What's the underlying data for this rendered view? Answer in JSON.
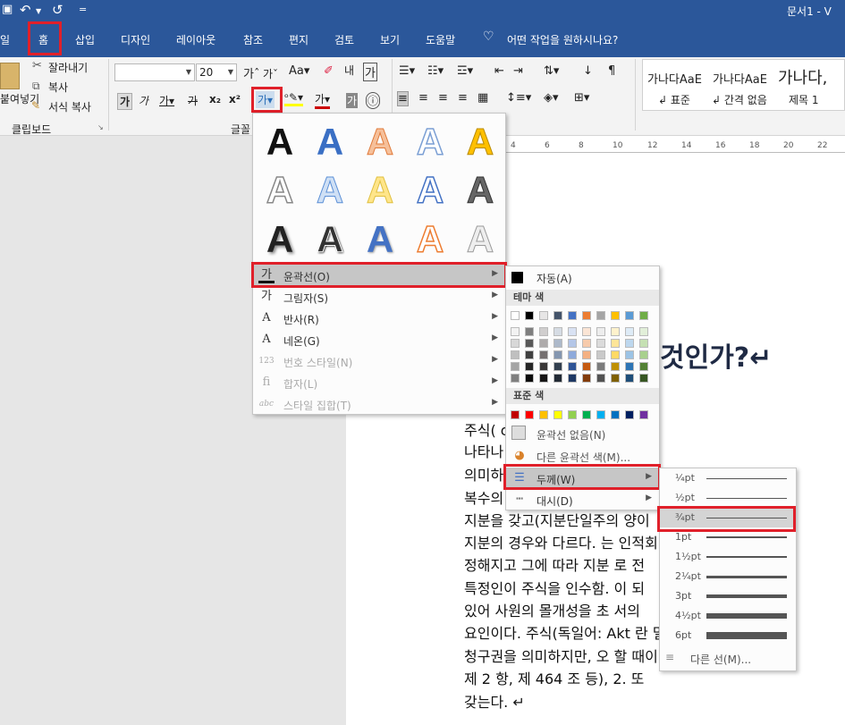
{
  "titlebar": {
    "quick_access": [
      "↶",
      "↺",
      "="
    ],
    "doc_title": "문서1 - V"
  },
  "tabs": [
    "일",
    "홈",
    "삽입",
    "디자인",
    "레이아웃",
    "참조",
    "편지",
    "검토",
    "보기",
    "도움말"
  ],
  "tellme": "어떤 작업을 원하시나요?",
  "ribbon": {
    "clipboard": {
      "paste": "붙여넣기",
      "cut": "잘라내기",
      "copy": "복사",
      "format_painter": "서식 복사",
      "group": "클립보드"
    },
    "font": {
      "size": "20",
      "group": "글꼴"
    },
    "styles": [
      {
        "preview": "가나다AaE",
        "name": "↲ 표준"
      },
      {
        "preview": "가나다AaE",
        "name": "↲ 간격 없음"
      },
      {
        "preview": "가나다,",
        "name": "제목 1"
      }
    ]
  },
  "ruler_marks": [
    "4",
    "6",
    "8",
    "10",
    "12",
    "14",
    "16",
    "18",
    "20",
    "22"
  ],
  "document": {
    "heading": "것인가?↵",
    "lines": [
      "주식(     ock)이란 사원인 주주가",
      "나타나     주식회사의 지분인 주식",
      "의미하",
      "복수의                  의) 유",
      "지분을 갖고(지분단일주의           양이",
      "지분의 경우와 다르다. 는            인적회",
      "정해지고 그에 따라 지분            로 전",
      "특정인이 주식을 인수함.           이 되",
      "있어 사원의 몰개성을 초           서의",
      "요인이다. 주식(독일어: Akt           란 밀",
      "청구권을 의미하지만, 오           할 때이",
      "제 2 항, 제 464 조 등), 2.          또",
      "갖는다. ↵"
    ]
  },
  "texteffects_menu": {
    "items": [
      {
        "icon": "가",
        "label": "윤곽선(O)",
        "submenu": true,
        "disabled": false,
        "highlighted": true
      },
      {
        "icon": "가",
        "label": "그림자(S)",
        "submenu": true,
        "disabled": false,
        "highlighted": false
      },
      {
        "icon": "A",
        "label": "반사(R)",
        "submenu": true,
        "disabled": false,
        "highlighted": false
      },
      {
        "icon": "A",
        "label": "네온(G)",
        "submenu": true,
        "disabled": false,
        "highlighted": false
      },
      {
        "icon": "123",
        "label": "번호 스타일(N)",
        "submenu": true,
        "disabled": true,
        "highlighted": false
      },
      {
        "icon": "fi",
        "label": "합자(L)",
        "submenu": true,
        "disabled": true,
        "highlighted": false
      },
      {
        "icon": "abc",
        "label": "스타일 집합(T)",
        "submenu": true,
        "disabled": true,
        "highlighted": false
      }
    ]
  },
  "outline_menu": {
    "auto": "자동(A)",
    "theme_header": "테마 색",
    "standard_header": "표준 색",
    "no_outline": "윤곽선 없음(N)",
    "more_colors": "다른 윤곽선 색(M)...",
    "weight": "두께(W)",
    "dash": "대시(D)",
    "theme_top": [
      "#ffffff",
      "#000000",
      "#e7e6e6",
      "#44546a",
      "#4472c4",
      "#ed7d31",
      "#a5a5a5",
      "#ffc000",
      "#5b9bd5",
      "#70ad47"
    ],
    "theme_shades": [
      [
        "#f2f2f2",
        "#7f7f7f",
        "#d0cece",
        "#d6dce4",
        "#d9e2f3",
        "#fbe5d5",
        "#ededed",
        "#fff2cc",
        "#deebf6",
        "#e2efd9"
      ],
      [
        "#d8d8d8",
        "#595959",
        "#aeabab",
        "#adb9ca",
        "#b4c6e7",
        "#f7cbac",
        "#dbdbdb",
        "#fee599",
        "#bdd7ee",
        "#c5e0b3"
      ],
      [
        "#bfbfbf",
        "#3f3f3f",
        "#757070",
        "#8496b0",
        "#8eaadb",
        "#f4b183",
        "#c9c9c9",
        "#ffd965",
        "#9cc3e5",
        "#a8d08d"
      ],
      [
        "#a5a5a5",
        "#262626",
        "#3a3838",
        "#323f4f",
        "#2f5496",
        "#c55a11",
        "#7b7b7b",
        "#bf9000",
        "#2e75b5",
        "#538135"
      ],
      [
        "#7f7f7f",
        "#0c0c0c",
        "#171616",
        "#222a35",
        "#1f3864",
        "#833c0b",
        "#525252",
        "#7f6000",
        "#1e4e79",
        "#375623"
      ]
    ],
    "standard": [
      "#c00000",
      "#ff0000",
      "#ffc000",
      "#ffff00",
      "#92d050",
      "#00b050",
      "#00b0f0",
      "#0070c0",
      "#002060",
      "#7030a0"
    ]
  },
  "weight_menu": {
    "weights": [
      "¼pt",
      "½pt",
      "¾pt",
      "1pt",
      "1½pt",
      "2¼pt",
      "3pt",
      "4½pt",
      "6pt"
    ],
    "more": "다른 선(M)..."
  }
}
